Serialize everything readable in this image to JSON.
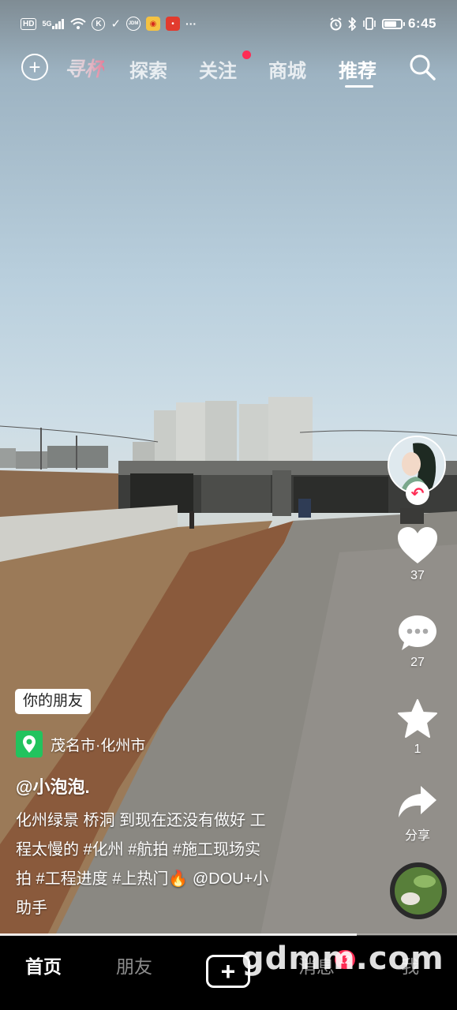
{
  "status_bar": {
    "left_icons": [
      "hd-icon",
      "signal-5g-icon",
      "wifi-icon",
      "app-k-icon",
      "app-check-icon",
      "app-jdm-icon",
      "weibo-icon",
      "app-red-icon",
      "more-dots-icon"
    ],
    "hd_label": "HD",
    "network_label": "5G",
    "jdm_label": "JDM",
    "time": "6:45",
    "battery_level": 0.75
  },
  "top_nav": {
    "cup_label": "寻杯",
    "tabs": [
      {
        "label": "探索",
        "active": false
      },
      {
        "label": "关注",
        "active": false,
        "has_dot": true
      },
      {
        "label": "商城",
        "active": false
      },
      {
        "label": "推荐",
        "active": true
      }
    ]
  },
  "right_rail": {
    "like_count": "37",
    "comment_count": "27",
    "favorite_count": "1",
    "share_label": "分享"
  },
  "post": {
    "friend_tag": "你的朋友",
    "location": "茂名市·化州市",
    "author": "@小泡泡.",
    "caption_lines": [
      "化州绿景 桥洞 到现在还没有做好 工",
      "程太慢的 #化州 #航拍 #施工现场实",
      "拍 #工程进度 #上热门🔥 @DOU+小",
      "助手"
    ],
    "progress": 0.78
  },
  "bottom_nav": {
    "home": "首页",
    "friends": "朋友",
    "messages": "消息",
    "messages_badge": "12",
    "me": "我"
  },
  "watermark": "gdmm.com",
  "colors": {
    "accent": "#fe2c55",
    "location_green": "#22c35e"
  }
}
